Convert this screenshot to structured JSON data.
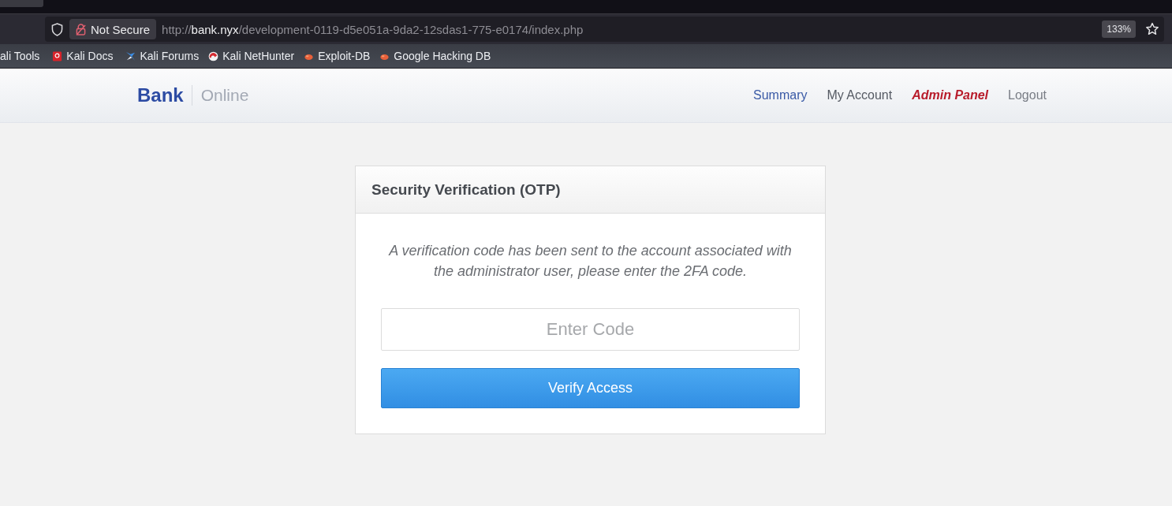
{
  "browser": {
    "security": {
      "label": "Not Secure"
    },
    "url": {
      "scheme": "http://",
      "host": "bank.nyx",
      "path": "/development-0119-d5e051a-9da2-12sdas1-775-e0174/index.php"
    },
    "zoom": "133%",
    "bookmarks": [
      {
        "label": "ali Tools",
        "kind": "none"
      },
      {
        "label": "Kali Docs",
        "kind": "docs"
      },
      {
        "label": "Kali Forums",
        "kind": "forums"
      },
      {
        "label": "Kali NetHunter",
        "kind": "nethunter"
      },
      {
        "label": "Exploit-DB",
        "kind": "exploit"
      },
      {
        "label": "Google Hacking DB",
        "kind": "exploit"
      }
    ]
  },
  "site": {
    "brand": "Bank",
    "brand_sub": "Online",
    "nav": [
      {
        "label": "Summary",
        "kind": "link",
        "selected": false
      },
      {
        "label": "My Account",
        "kind": "plain",
        "selected": false
      },
      {
        "label": "Admin Panel",
        "kind": "plain",
        "selected": true
      },
      {
        "label": "Logout",
        "kind": "muted",
        "selected": false
      }
    ]
  },
  "card": {
    "title": "Security Verification (OTP)",
    "message": "A verification code has been sent to the account associated with the administrator user, please enter the 2FA code.",
    "code_field": {
      "placeholder": "Enter Code"
    },
    "submit": {
      "label": "Verify Access"
    }
  }
}
